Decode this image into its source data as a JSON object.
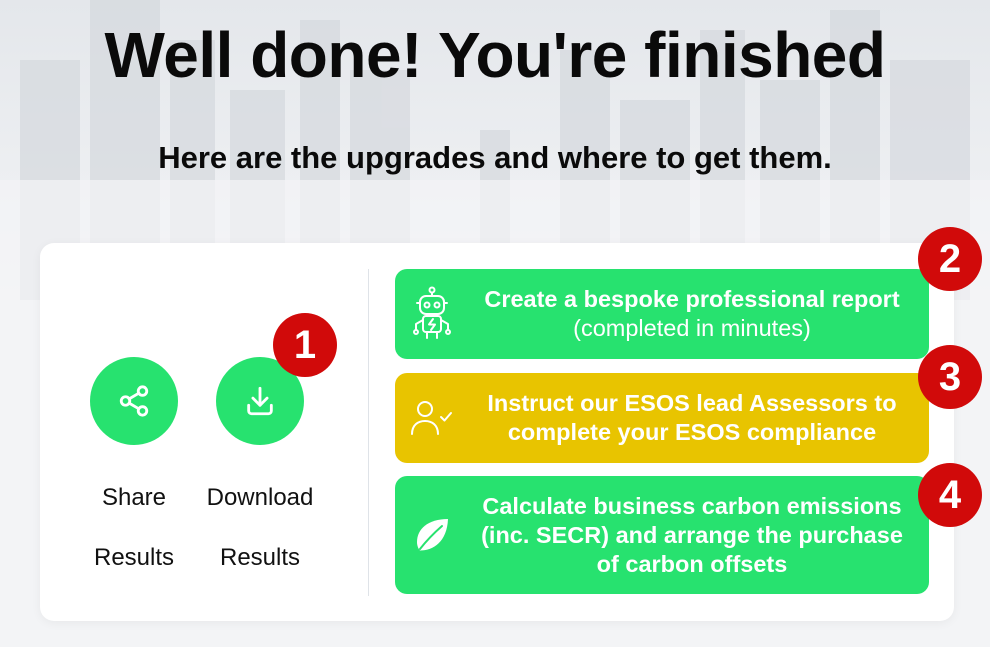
{
  "header": {
    "title": "Well done! You're finished",
    "subtitle": "Here are the upgrades and where to get them."
  },
  "actions": {
    "share": {
      "line1": "Share",
      "line2": "Results",
      "icon": "share-icon"
    },
    "download": {
      "line1": "Download",
      "line2": "Results",
      "icon": "download-icon"
    }
  },
  "steps": [
    "1",
    "2",
    "3",
    "4"
  ],
  "options": [
    {
      "bold": "Create a bespoke professional report",
      "normal": "(completed in minutes)",
      "icon": "robot-icon",
      "color": "#27e26f"
    },
    {
      "bold": "Instruct our ESOS lead Assessors to complete your ESOS compliance",
      "normal": "",
      "icon": "user-check-icon",
      "color": "#e8c400"
    },
    {
      "bold": "Calculate business carbon emissions (inc. SECR) and arrange the purchase of carbon offsets",
      "normal": "",
      "icon": "leaf-icon",
      "color": "#27e26f"
    }
  ],
  "colors": {
    "accent_green": "#27e26f",
    "accent_yellow": "#e8c400",
    "badge_red": "#d10a0a"
  }
}
